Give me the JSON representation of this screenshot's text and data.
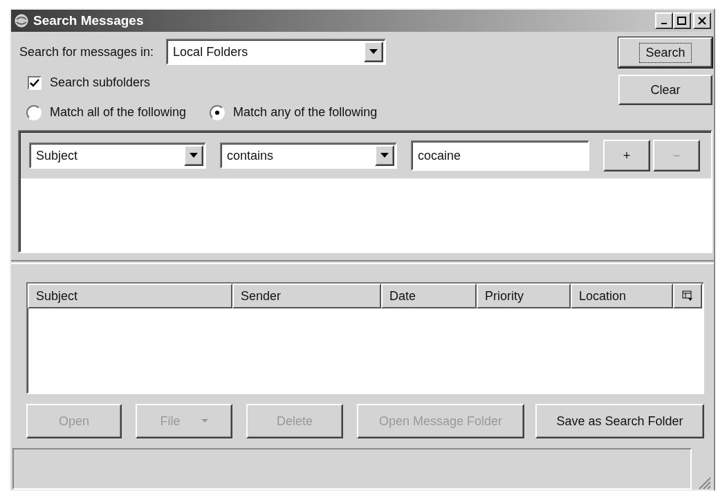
{
  "window": {
    "title": "Search Messages"
  },
  "search_in": {
    "label": "Search for messages in:",
    "value": "Local Folders"
  },
  "actions": [
    {
      "label": "Search",
      "focused": true
    },
    {
      "label": "Clear",
      "focused": false
    }
  ],
  "search_subfolders": {
    "label": "Search subfolders",
    "checked": true
  },
  "match_options": [
    {
      "label": "Match all of the following",
      "selected": false
    },
    {
      "label": "Match any of the following",
      "selected": true
    }
  ],
  "criteria": [
    {
      "field": "Subject",
      "operator": "contains",
      "value": "cocaine"
    }
  ],
  "criterion_buttons": [
    {
      "label": "+",
      "disabled": false
    },
    {
      "label": "−",
      "disabled": true
    }
  ],
  "results": {
    "columns": [
      "Subject",
      "Sender",
      "Date",
      "Priority",
      "Location"
    ]
  },
  "buttons": [
    {
      "label": "Open",
      "disabled": true,
      "kind": "plain"
    },
    {
      "label": "File",
      "disabled": true,
      "kind": "menu"
    },
    {
      "label": "Delete",
      "disabled": true,
      "kind": "plain"
    },
    {
      "label": "Open Message Folder",
      "disabled": true,
      "kind": "plain"
    },
    {
      "label": "Save as Search Folder",
      "disabled": false,
      "kind": "plain"
    }
  ]
}
